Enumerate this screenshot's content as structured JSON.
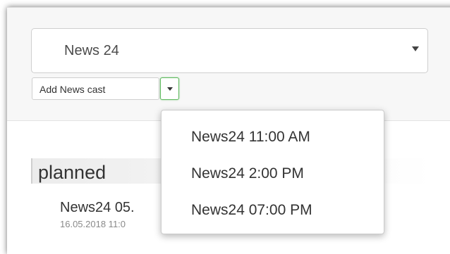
{
  "channel_select": {
    "value": "News 24"
  },
  "add_button": {
    "label": "Add News cast"
  },
  "section": {
    "heading": "planned"
  },
  "planned_item": {
    "title": "News24 05.",
    "date": "16.05.2018 11:0"
  },
  "dropdown_menu": {
    "items": [
      {
        "label": "News24 11:00 AM"
      },
      {
        "label": "News24 2:00 PM"
      },
      {
        "label": "News24 07:00 PM"
      }
    ]
  },
  "colors": {
    "toggle_border": "#5cb85c",
    "text": "#333333",
    "muted": "#8a8a8a"
  }
}
